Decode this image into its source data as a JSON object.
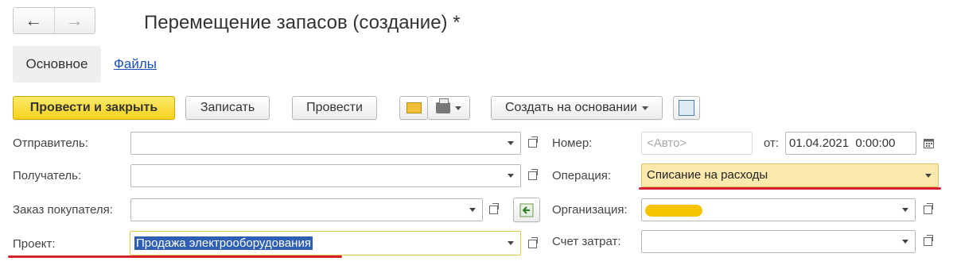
{
  "window": {
    "title": "Перемещение запасов (создание) *",
    "back_icon": "←",
    "forward_icon": "→"
  },
  "tabs": [
    {
      "label": "Основное",
      "active": true
    },
    {
      "label": "Файлы",
      "active": false
    }
  ],
  "toolbar": {
    "post_close": "Провести и закрыть",
    "save": "Записать",
    "post": "Провести",
    "create_based_on": "Создать на основании"
  },
  "form": {
    "sender": {
      "label": "Отправитель:",
      "value": ""
    },
    "recipient": {
      "label": "Получатель:",
      "value": ""
    },
    "customer_order": {
      "label": "Заказ покупателя:",
      "value": ""
    },
    "project": {
      "label": "Проект:",
      "value": "Продажа электрооборудования"
    },
    "number": {
      "label": "Номер:",
      "placeholder": "<Авто>"
    },
    "date": {
      "label": "от:",
      "value": "01.04.2021  0:00:00"
    },
    "operation": {
      "label": "Операция:",
      "value": "Списание на расходы"
    },
    "organization": {
      "label": "Организация:",
      "value": ""
    },
    "cost_account": {
      "label": "Счет затрат:",
      "value": ""
    }
  },
  "colors": {
    "primary_button": "#f5d21d",
    "highlight_field": "#fbe9ae",
    "selection": "#2f5fb5",
    "underline": "#d4202f",
    "redacted": "#f5c400"
  }
}
